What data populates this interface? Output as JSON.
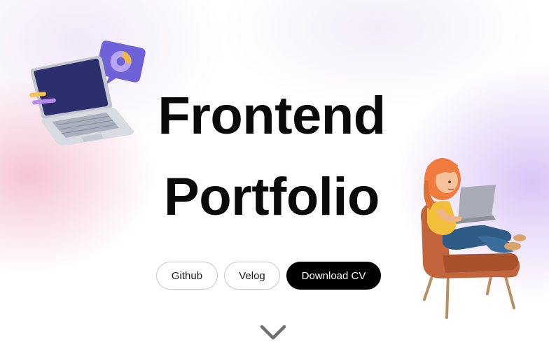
{
  "hero": {
    "title_line1": "Frontend",
    "title_line2": "Portfolio"
  },
  "buttons": {
    "github_label": "Github",
    "velog_label": "Velog",
    "download_label": "Download CV"
  },
  "icons": {
    "scroll_down": "chevron-down-icon",
    "laptop": "laptop-illustration",
    "person": "person-with-laptop-illustration"
  },
  "colors": {
    "title": "#0a0a0a",
    "primary_button_bg": "#000000",
    "primary_button_text": "#ffffff",
    "outline_border": "#c9c9c9",
    "pink_glow": "#ee96af",
    "purple_glow": "#be96f0"
  }
}
